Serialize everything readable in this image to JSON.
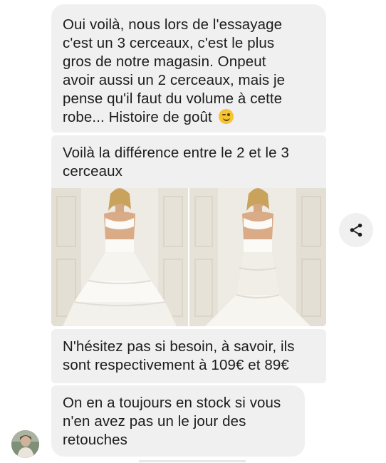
{
  "messages": [
    {
      "lines": [
        "Oui voilà, nous lors de l'essayage",
        "c'est un 3 cerceaux, c'est le plus",
        "gros de notre magasin. Onpeut",
        "avoir aussi un 2 cerceaux, mais je",
        "pense qu'il faut du volume à cette",
        "robe... Histoire de goût"
      ],
      "emoji": "winking-face"
    },
    {
      "lines": [
        "Voilà la différence entre le 2 et le 3",
        "cerceaux"
      ]
    },
    {
      "lines": [
        "N'hésitez pas si besoin, à savoir, ils",
        "sont respectivement à 109€ et 89€"
      ]
    },
    {
      "lines": [
        "On en a toujours en stock si vous",
        "n'en avez pas un le jour des",
        "retouches"
      ]
    }
  ],
  "attachments": [
    {
      "icon": "petticoat-3-hoops-photo"
    },
    {
      "icon": "petticoat-2-hoops-photo"
    }
  ],
  "icons": {
    "share": "share-icon",
    "avatar": "sender-avatar"
  },
  "colors": {
    "bubble": "#f0f0f0",
    "text": "#1c1c1c",
    "emoji": "#f5c431"
  }
}
